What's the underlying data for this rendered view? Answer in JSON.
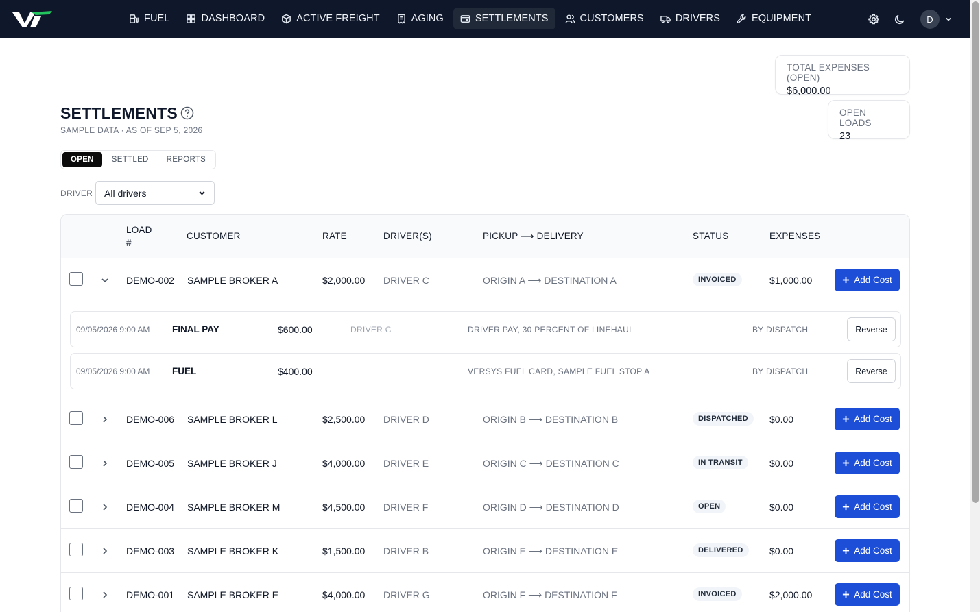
{
  "nav": {
    "items": [
      {
        "label": "FUEL",
        "icon": "fuel-pump-icon"
      },
      {
        "label": "DASHBOARD",
        "icon": "dashboard-grid-icon"
      },
      {
        "label": "ACTIVE FREIGHT",
        "icon": "package-icon"
      },
      {
        "label": "AGING",
        "icon": "receipt-icon"
      },
      {
        "label": "SETTLEMENTS",
        "icon": "wallet-icon",
        "active": true
      },
      {
        "label": "CUSTOMERS",
        "icon": "users-icon"
      },
      {
        "label": "DRIVERS",
        "icon": "truck-icon"
      },
      {
        "label": "EQUIPMENT",
        "icon": "wrench-icon"
      }
    ],
    "avatar_initial": "D"
  },
  "stats": {
    "total_expenses_label": "TOTAL EXPENSES (OPEN)",
    "total_expenses_value": "$6,000.00",
    "open_loads_label": "OPEN LOADS",
    "open_loads_value": "23"
  },
  "page": {
    "title": "SETTLEMENTS",
    "subtitle": "SAMPLE DATA · AS OF SEP 5, 2026"
  },
  "tabs": [
    "OPEN",
    "SETTLED",
    "REPORTS"
  ],
  "filter": {
    "label": "DRIVER",
    "value": "All drivers"
  },
  "table": {
    "headers": {
      "load": "LOAD #",
      "customer": "CUSTOMER",
      "rate": "RATE",
      "drivers": "DRIVER(S)",
      "route": "PICKUP ⟶ DELIVERY",
      "status": "STATUS",
      "expenses": "EXPENSES"
    },
    "add_cost_label": "Add Cost",
    "reverse_label": "Reverse",
    "rows": [
      {
        "load": "DEMO-002",
        "customer": "SAMPLE BROKER A",
        "rate": "$2,000.00",
        "driver": "DRIVER C",
        "route": "ORIGIN A ⟶ DESTINATION A",
        "status": "INVOICED",
        "expenses": "$1,000.00",
        "expanded": true
      },
      {
        "load": "DEMO-006",
        "customer": "SAMPLE BROKER L",
        "rate": "$2,500.00",
        "driver": "DRIVER D",
        "route": "ORIGIN B ⟶ DESTINATION B",
        "status": "DISPATCHED",
        "expenses": "$0.00"
      },
      {
        "load": "DEMO-005",
        "customer": "SAMPLE BROKER J",
        "rate": "$4,000.00",
        "driver": "DRIVER E",
        "route": "ORIGIN C ⟶ DESTINATION C",
        "status": "IN TRANSIT",
        "expenses": "$0.00"
      },
      {
        "load": "DEMO-004",
        "customer": "SAMPLE BROKER M",
        "rate": "$4,500.00",
        "driver": "DRIVER F",
        "route": "ORIGIN D ⟶ DESTINATION D",
        "status": "OPEN",
        "expenses": "$0.00"
      },
      {
        "load": "DEMO-003",
        "customer": "SAMPLE BROKER K",
        "rate": "$1,500.00",
        "driver": "DRIVER B",
        "route": "ORIGIN E ⟶ DESTINATION E",
        "status": "DELIVERED",
        "expenses": "$0.00"
      },
      {
        "load": "DEMO-001",
        "customer": "SAMPLE BROKER E",
        "rate": "$4,000.00",
        "driver": "DRIVER G",
        "route": "ORIGIN F ⟶ DESTINATION F",
        "status": "INVOICED",
        "expenses": "$2,000.00"
      }
    ],
    "details": [
      {
        "date": "09/05/2026 9:00 AM",
        "type": "FINAL PAY",
        "amount": "$600.00",
        "driver": "DRIVER C",
        "description": "DRIVER PAY, 30 PERCENT OF LINEHAUL",
        "by": "BY DISPATCH"
      },
      {
        "date": "09/05/2026 9:00 AM",
        "type": "FUEL",
        "amount": "$400.00",
        "driver": "",
        "description": "VERSYS FUEL CARD, SAMPLE FUEL STOP A",
        "by": "BY DISPATCH"
      }
    ]
  },
  "colors": {
    "nav_bg": "#0f172a",
    "accent": "#1d4ed8",
    "badge_bg": "#f1f5f9"
  }
}
